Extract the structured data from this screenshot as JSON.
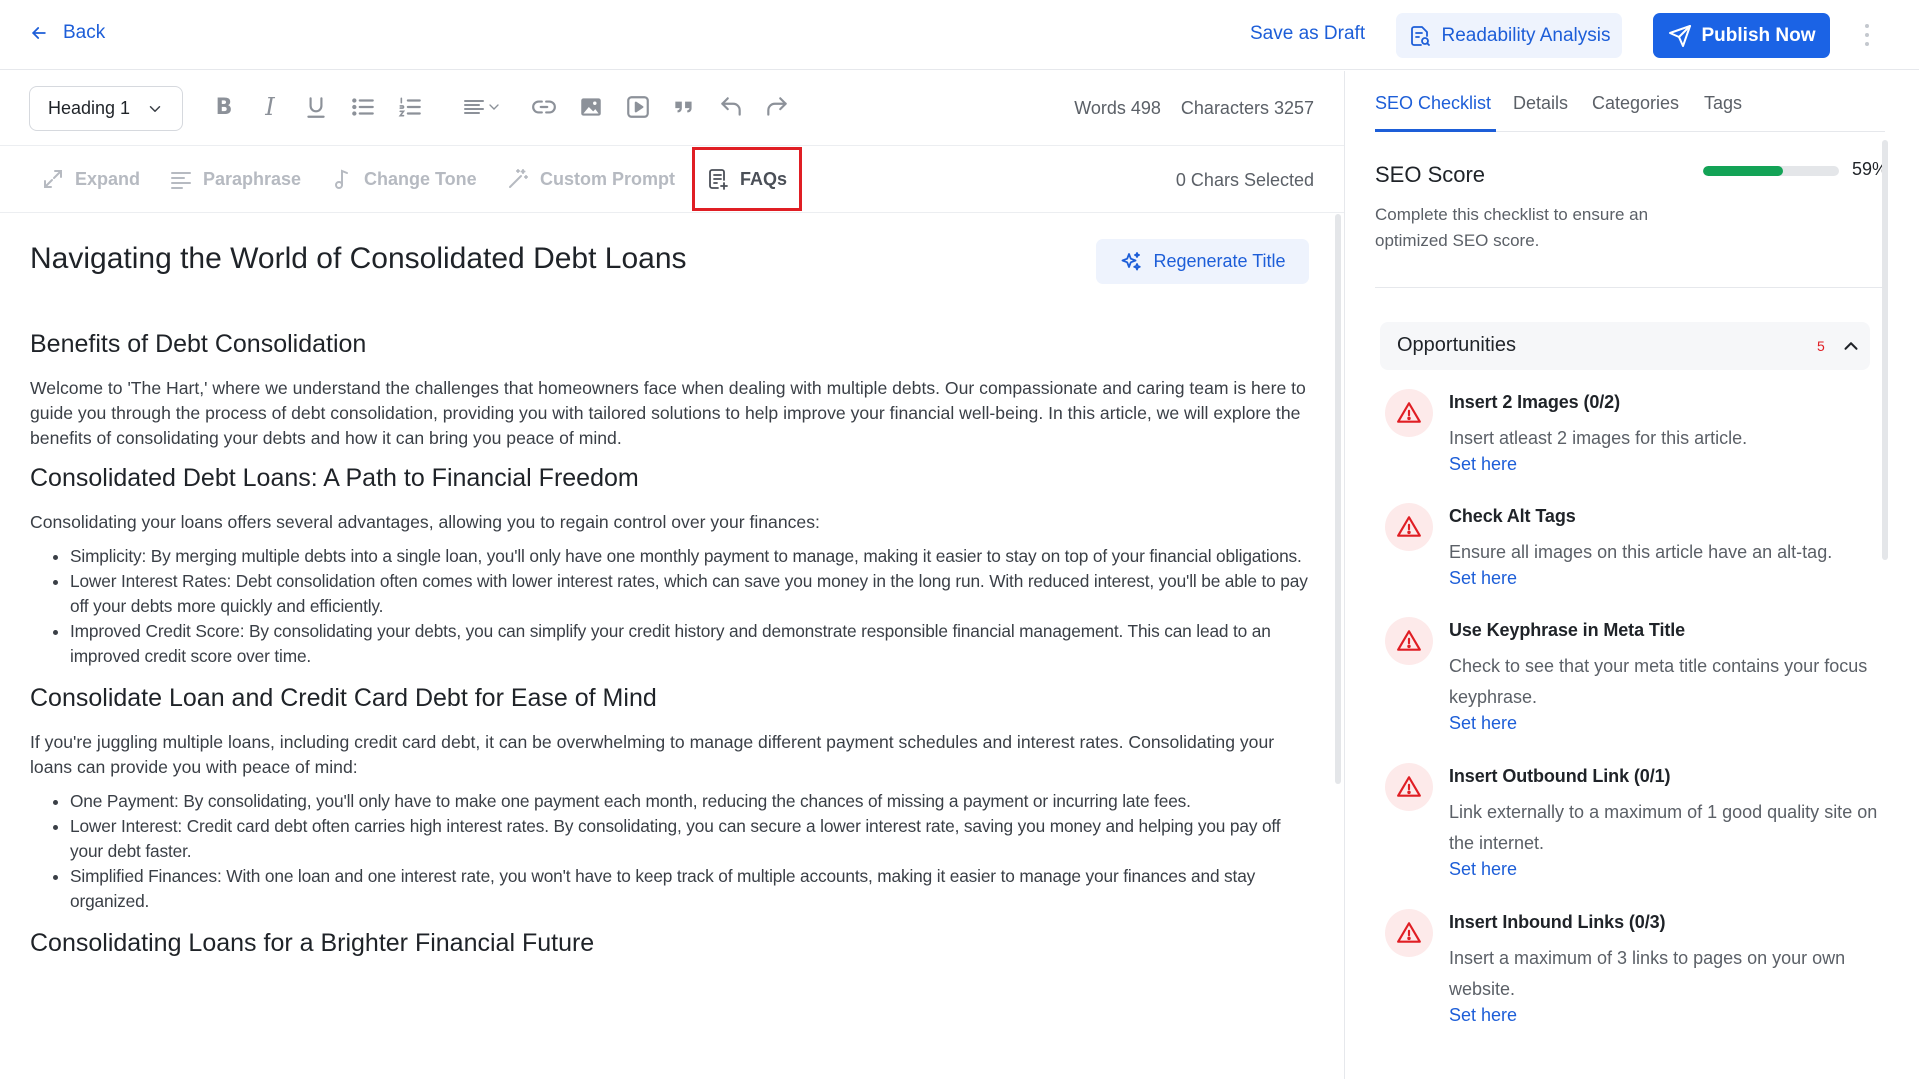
{
  "topbar": {
    "back_label": "Back",
    "save_draft_label": "Save as Draft",
    "readability_label": "Readability Analysis",
    "publish_label": "Publish Now"
  },
  "editor": {
    "heading_select": "Heading 1",
    "words_label": "Words 498",
    "characters_label": "Characters 3257",
    "ai_tools": {
      "expand": "Expand",
      "paraphrase": "Paraphrase",
      "change_tone": "Change Tone",
      "custom_prompt": "Custom Prompt",
      "faqs": "FAQs"
    },
    "chars_selected": "0 Chars Selected",
    "regenerate_title_label": "Regenerate Title",
    "article": {
      "title": "Navigating the World of Consolidated Debt Loans",
      "sections": [
        {
          "heading": "Benefits of Debt Consolidation",
          "paragraph": "Welcome to 'The Hart,' where we understand the challenges that homeowners face when dealing with multiple debts. Our compassionate and caring team is here to guide you through the process of debt consolidation, providing you with tailored solutions to help improve your financial well-being. In this article, we will explore the benefits of consolidating your debts and how it can bring you peace of mind."
        },
        {
          "heading": "Consolidated Debt Loans: A Path to Financial Freedom",
          "paragraph": "Consolidating your loans offers several advantages, allowing you to regain control over your finances:",
          "bullets": [
            "Simplicity: By merging multiple debts into a single loan, you'll only have one monthly payment to manage, making it easier to stay on top of your financial obligations.",
            "Lower Interest Rates: Debt consolidation often comes with lower interest rates, which can save you money in the long run. With reduced interest, you'll be able to pay off your debts more quickly and efficiently.",
            "Improved Credit Score: By consolidating your debts, you can simplify your credit history and demonstrate responsible financial management. This can lead to an improved credit score over time."
          ]
        },
        {
          "heading": "Consolidate Loan and Credit Card Debt for Ease of Mind",
          "paragraph": "If you're juggling multiple loans, including credit card debt, it can be overwhelming to manage different payment schedules and interest rates. Consolidating your loans can provide you with peace of mind:",
          "bullets": [
            "One Payment: By consolidating, you'll only have to make one payment each month, reducing the chances of missing a payment or incurring late fees.",
            "Lower Interest: Credit card debt often carries high interest rates. By consolidating, you can secure a lower interest rate, saving you money and helping you pay off your debt faster.",
            "Simplified Finances: With one loan and one interest rate, you won't have to keep track of multiple accounts, making it easier to manage your finances and stay organized."
          ]
        },
        {
          "heading": "Consolidating Loans for a Brighter Financial Future"
        }
      ]
    }
  },
  "sidebar": {
    "tabs": [
      "SEO Checklist",
      "Details",
      "Categories",
      "Tags"
    ],
    "seo_score_title": "SEO Score",
    "seo_score_value": 0.59,
    "seo_score_label": "59%",
    "seo_desc": "Complete this checklist to ensure an optimized SEO score.",
    "opportunities_title": "Opportunities",
    "opportunities_count": "5",
    "set_here_label": "Set here",
    "items": [
      {
        "title": "Insert 2 Images (0/2)",
        "desc": "Insert atleast 2 images for this article."
      },
      {
        "title": "Check Alt Tags",
        "desc": "Ensure all images on this article have an alt-tag."
      },
      {
        "title": "Use Keyphrase in Meta Title",
        "desc": "Check to see that your meta title contains your focus keyphrase."
      },
      {
        "title": "Insert Outbound Link (0/1)",
        "desc": "Link externally to a maximum of 1 good quality site on the internet."
      },
      {
        "title": "Insert Inbound Links (0/3)",
        "desc": "Insert a maximum of 3 links to pages on your own website."
      }
    ]
  },
  "colors": {
    "accent": "#1b63e5",
    "success": "#13a356",
    "danger": "#e01e24",
    "highlight_box": "#e01e24"
  }
}
